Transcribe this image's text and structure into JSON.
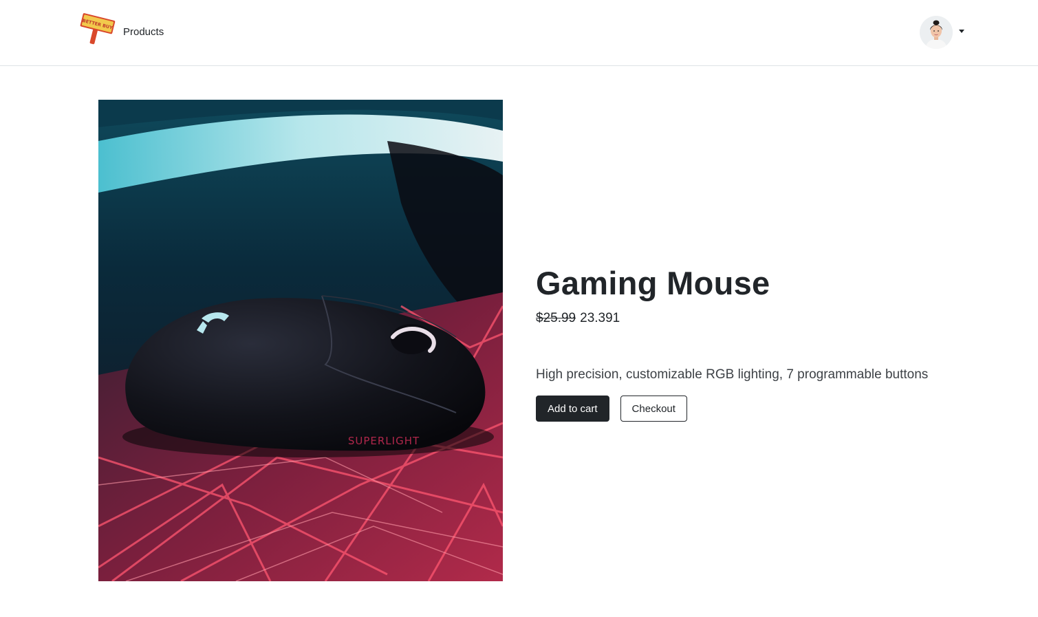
{
  "navbar": {
    "brand_logo_text": "BETTER BUY",
    "products_link": "Products"
  },
  "product": {
    "title": "Gaming Mouse",
    "original_price": "$25.99",
    "sale_price": "23.391",
    "description": "High precision, customizable RGB lighting, 7 programmable buttons",
    "image_text": "SUPERLIGHT",
    "add_to_cart_label": "Add to cart",
    "checkout_label": "Checkout"
  },
  "colors": {
    "text": "#212529",
    "button_dark": "#212529",
    "divider": "#dee2e6",
    "logo_sign": "#f2c94c",
    "logo_post": "#d9482b"
  }
}
